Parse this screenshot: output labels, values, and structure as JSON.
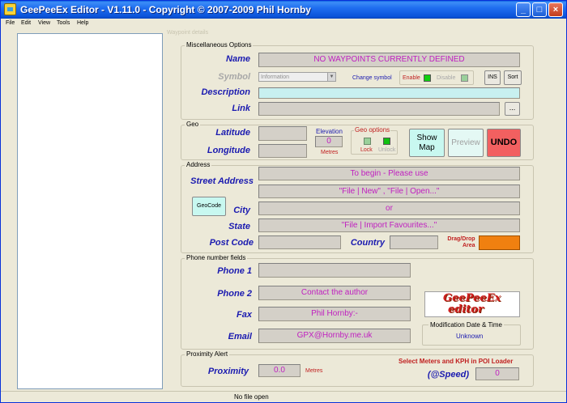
{
  "window": {
    "title": "GeePeeEx Editor - V1.11.0 - Copyright © 2007-2009 Phil Hornby",
    "minimize": "_",
    "maximize": "□",
    "close": "×"
  },
  "menu": [
    "File",
    "Edit",
    "View",
    "Tools",
    "Help"
  ],
  "waypoint_details_legend": "Waypoint details",
  "misc": {
    "title": "Miscellaneous Options",
    "name_label": "Name",
    "name_value": "NO WAYPOINTS CURRENTLY DEFINED",
    "symbol_label": "Symbol",
    "symbol_value": "Information",
    "change_symbol": "Change symbol",
    "enable": "Enable",
    "disable": "Disable",
    "ins_button": "INS",
    "sort_button": "Sort",
    "description_label": "Description",
    "link_label": "Link",
    "link_button": "..."
  },
  "geo": {
    "title": "Geo",
    "latitude_label": "Latitude",
    "longitude_label": "Longitude",
    "elevation_label": "Elevation",
    "elevation_value": "0",
    "elevation_unit": "Metres",
    "geo_options_label": "Geo options",
    "lock": "Lock",
    "unlock": "Unlock",
    "show_map_line1": "Show",
    "show_map_line2": "Map",
    "preview_button": "Preview",
    "undo_button": "UNDO"
  },
  "address": {
    "title": "Address",
    "street_label": "Street Address",
    "city_label": "City",
    "state_label": "State",
    "postcode_label": "Post Code",
    "country_label": "Country",
    "geocode_button": "GeoCode",
    "line1": "To begin -  Please use",
    "line2": "\"File | New\" , \"File | Open...\"",
    "line3": "or",
    "line4": "\"File | Import Favourites...\"",
    "dragdrop_line1": "Drag/Drop",
    "dragdrop_line2": "Area"
  },
  "phone": {
    "title": "Phone number fields",
    "phone1_label": "Phone 1",
    "phone2_label": "Phone 2",
    "fax_label": "Fax",
    "email_label": "Email",
    "phone2_value": "Contact the author",
    "fax_value": "Phil Hornby:-",
    "email_value": "GPX@Hornby.me.uk",
    "logo_line1": "GeePeeEx",
    "logo_line2": "editor",
    "mod_label": "Modification Date & Time",
    "mod_value": "Unknown"
  },
  "proximity": {
    "title": "Proximity Alert",
    "proximity_label": "Proximity",
    "proximity_value": "0.0",
    "proximity_unit": "Metres",
    "note": "Select Meters and KPH in POI Loader",
    "speed_label": "(@Speed)",
    "speed_value": "0"
  },
  "status": "No file open",
  "colors": {
    "enable_green": "#10d010",
    "undo_red": "#f26060",
    "drag_orange": "#f08010",
    "field_cyan": "#c8f0f0"
  }
}
